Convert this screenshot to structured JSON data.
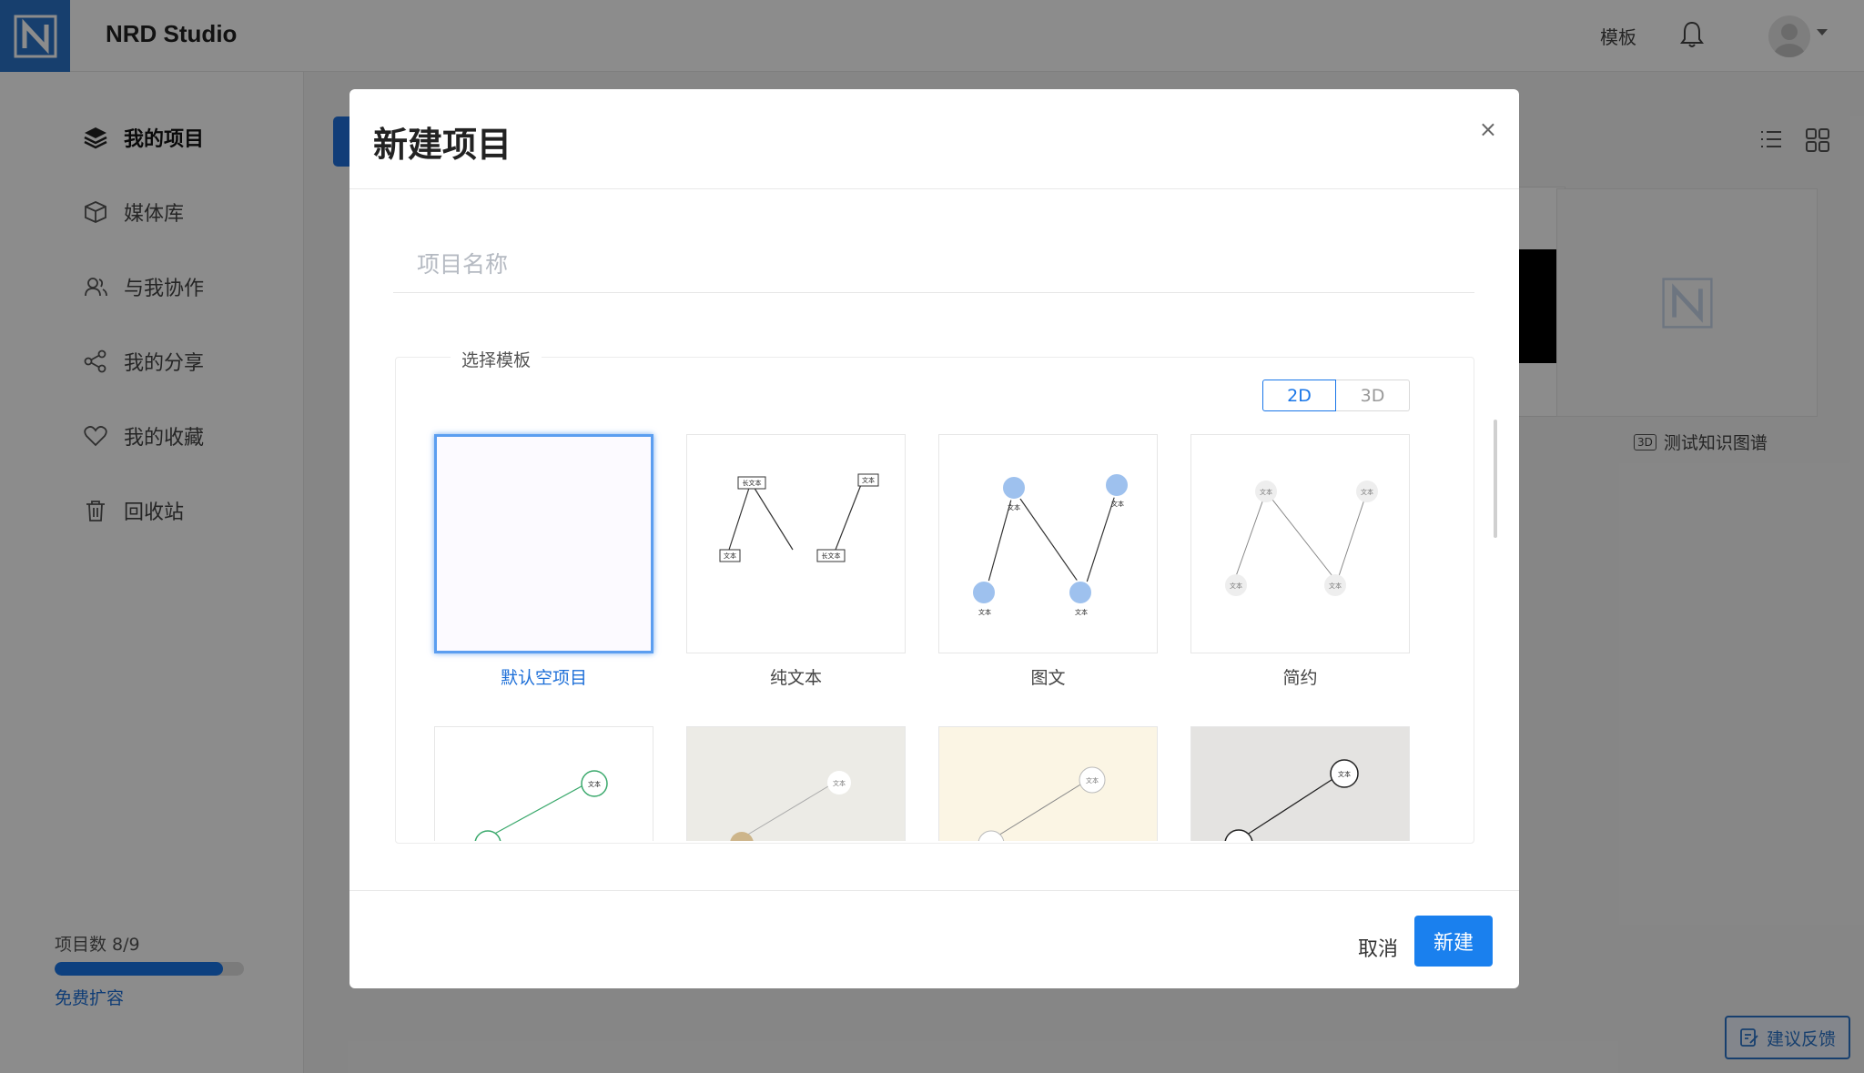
{
  "app": {
    "title": "NRD Studio"
  },
  "topbar": {
    "template_link": "模板"
  },
  "sidebar": {
    "items": [
      {
        "label": "我的项目",
        "icon": "layers-icon"
      },
      {
        "label": "媒体库",
        "icon": "box-icon"
      },
      {
        "label": "与我协作",
        "icon": "users-icon"
      },
      {
        "label": "我的分享",
        "icon": "share-icon"
      },
      {
        "label": "我的收藏",
        "icon": "heart-icon"
      },
      {
        "label": "回收站",
        "icon": "trash-icon"
      }
    ],
    "quota": {
      "label": "项目数 8/9",
      "used": 8,
      "total": 9,
      "link": "免费扩容"
    }
  },
  "background": {
    "card_tag": "3D",
    "card_title": "测试知识图谱",
    "feedback": "建议反馈"
  },
  "modal": {
    "title": "新建项目",
    "close": "×",
    "name_placeholder": "项目名称",
    "section_label": "选择模板",
    "mode_options": [
      "2D",
      "3D"
    ],
    "selected_mode": "2D",
    "templates": [
      {
        "label": "默认空项目",
        "selected": true
      },
      {
        "label": "纯文本",
        "selected": false
      },
      {
        "label": "图文",
        "selected": false
      },
      {
        "label": "简约",
        "selected": false
      }
    ],
    "node_text": "文本",
    "long_node_text": "长文本",
    "cancel": "取消",
    "create": "新建"
  },
  "colors": {
    "primary": "#1976e8",
    "brand": "#2a73c9"
  }
}
